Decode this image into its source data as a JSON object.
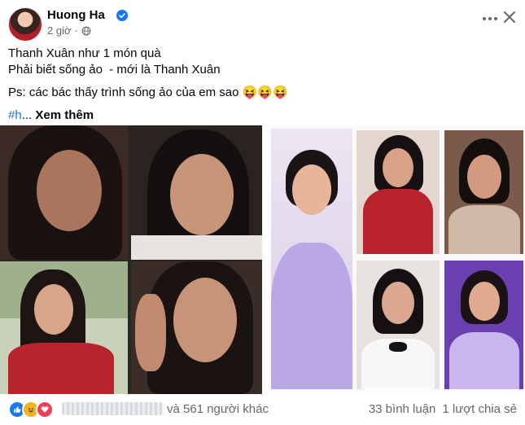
{
  "post": {
    "author": "Huong Ha",
    "time": "2 giờ",
    "privacy_icon": "globe-icon",
    "line1": "Thanh Xuân như 1 món quà",
    "line2": "Phải biết sống ảo  - mới là Thanh Xuân",
    "line3": "Ps: các bác thấy trình sống ảo của em sao 😝😝😝",
    "hashtag": "#h",
    "ellipsis": "...",
    "see_more": "Xem thêm"
  },
  "footer": {
    "reactions": [
      "like-icon",
      "haha-icon",
      "love-icon"
    ],
    "and_others": "và 561 người khác",
    "comments": "33 bình luận",
    "shares": "1 lượt chia sẻ"
  },
  "colors": {
    "verified": "#1877f2",
    "link": "#216fdb",
    "secondary_text": "#65676b",
    "like": "#1877f2",
    "love": "#f33e58",
    "haha": "#f7b125"
  }
}
